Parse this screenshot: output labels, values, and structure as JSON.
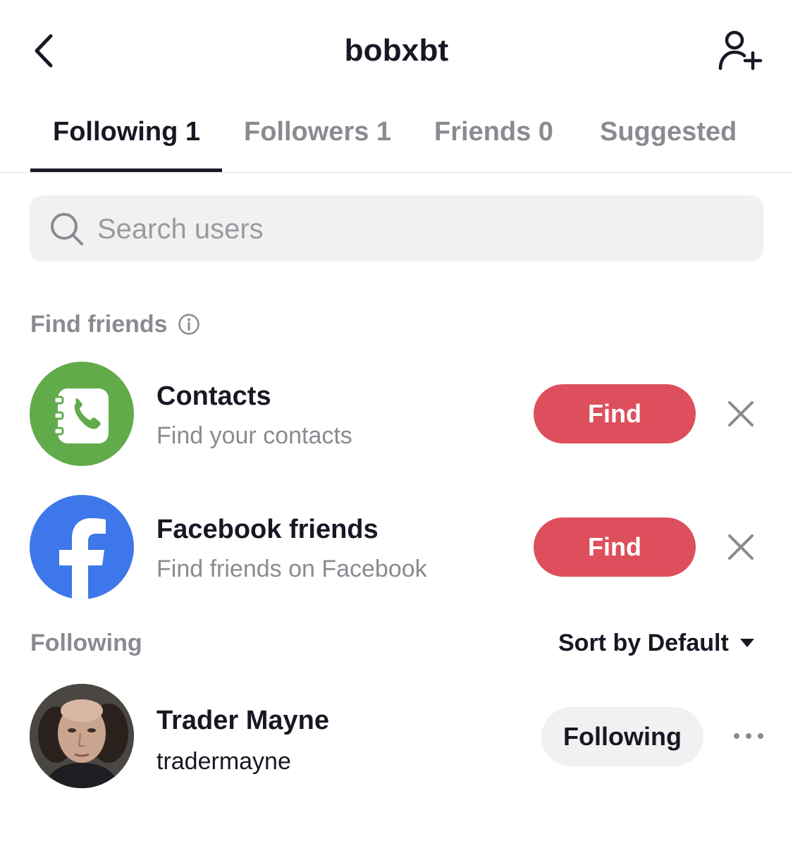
{
  "header": {
    "title": "bobxbt",
    "back_icon": "chevron-left-icon",
    "add_user_icon": "add-user-icon"
  },
  "tabs": [
    {
      "label": "Following 1",
      "active": true
    },
    {
      "label": "Followers 1",
      "active": false
    },
    {
      "label": "Friends 0",
      "active": false
    },
    {
      "label": "Suggested",
      "active": false
    }
  ],
  "search": {
    "placeholder": "Search users",
    "value": "",
    "icon": "search-icon"
  },
  "find_friends": {
    "label": "Find friends",
    "info_icon": "info-icon",
    "items": [
      {
        "title": "Contacts",
        "subtitle": "Find your contacts",
        "button_label": "Find",
        "icon": "contacts-book-icon",
        "icon_bg": "#62ab4b"
      },
      {
        "title": "Facebook friends",
        "subtitle": "Find friends on Facebook",
        "button_label": "Find",
        "icon": "facebook-icon",
        "icon_bg": "#3d77ea"
      }
    ]
  },
  "following_section": {
    "label": "Following",
    "sort_label": "Sort by Default",
    "sort_icon": "caret-down-icon",
    "users": [
      {
        "display_name": "Trader Mayne",
        "username": "tradermayne",
        "button_label": "Following",
        "more_icon": "more-horizontal-icon"
      }
    ]
  },
  "colors": {
    "accent": "#dd4f5c",
    "text_primary": "#161823",
    "text_secondary": "#8a8b91",
    "search_bg": "#f1f1f2"
  }
}
